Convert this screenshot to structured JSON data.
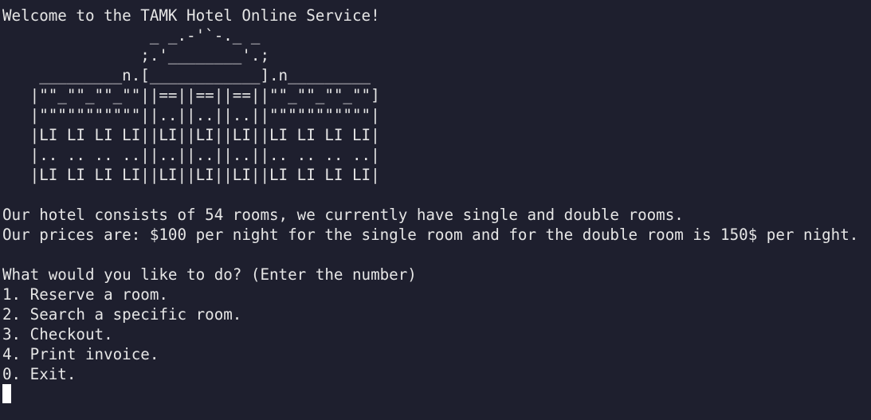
{
  "welcome": "Welcome to the TAMK Hotel Online Service!",
  "art": [
    "                _ _.-'`-._ _",
    "               ;.'________'.;",
    "    _________n.[____________].n_________",
    "   |\"\"_\"\"_\"\"_\"\"||==||==||==||\"\"_\"\"_\"\"_\"\"]",
    "   |\"\"\"\"\"\"\"\"\"\"\"||..||..||..||\"\"\"\"\"\"\"\"\"\"\"|",
    "   |LI LI LI LI||LI||LI||LI||LI LI LI LI|",
    "   |.. .. .. ..||..||..||..||.. .. .. ..|",
    "   |LI LI LI LI||LI||LI||LI||LI LI LI LI|"
  ],
  "info": [
    "Our hotel consists of 54 rooms, we currently have single and double rooms.",
    "Our prices are: $100 per night for the single room and for the double room is 150$ per night."
  ],
  "prompt": "What would you like to do? (Enter the number)",
  "menu": [
    "1. Reserve a room.",
    "2. Search a specific room.",
    "3. Checkout.",
    "4. Print invoice.",
    "0. Exit."
  ]
}
